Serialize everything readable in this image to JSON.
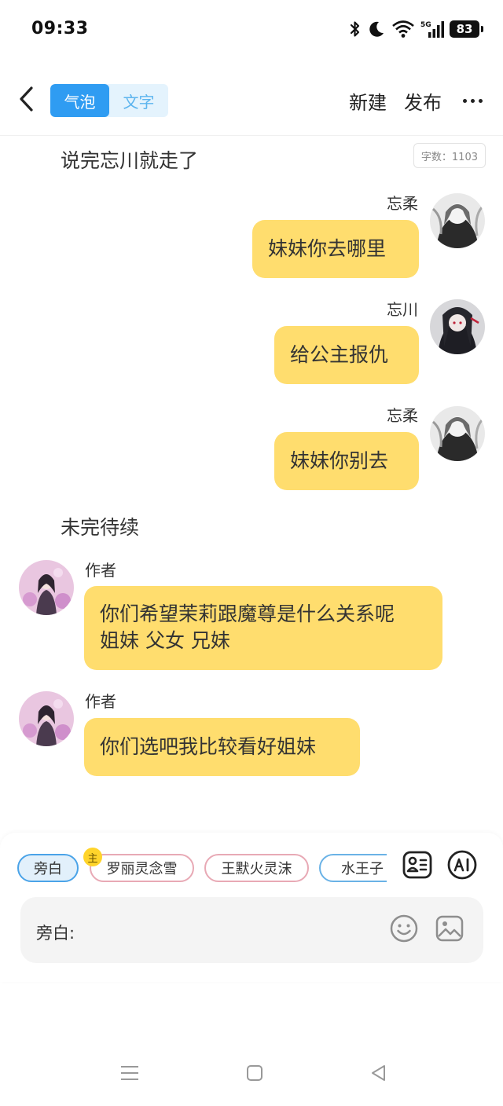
{
  "status_bar": {
    "time": "09:33",
    "battery": "83",
    "icons": [
      "bluetooth-icon",
      "moon-icon",
      "wifi-icon",
      "cellular-5g-icon",
      "battery-icon"
    ]
  },
  "header": {
    "back_icon": "chevron-left-icon",
    "tabs": [
      {
        "label": "气泡",
        "active": true
      },
      {
        "label": "文字",
        "active": false
      }
    ],
    "new_label": "新建",
    "publish_label": "发布",
    "more_icon": "more-dots-icon"
  },
  "word_count": "字数：1103",
  "messages": [
    {
      "type": "narration",
      "text": "说完忘川就走了"
    },
    {
      "type": "bubble",
      "side": "right",
      "speaker": "忘柔",
      "text": "妹妹你去哪里"
    },
    {
      "type": "bubble",
      "side": "right",
      "speaker": "忘川",
      "text": "给公主报仇"
    },
    {
      "type": "bubble",
      "side": "right",
      "speaker": "忘柔",
      "text": "妹妹你别去"
    },
    {
      "type": "narration",
      "text": "未完待续"
    },
    {
      "type": "bubble",
      "side": "left",
      "speaker": "作者",
      "line1": "你们希望茉莉跟魔尊是什么关系呢",
      "line2": "姐妹 父女 兄妹"
    },
    {
      "type": "bubble",
      "side": "left",
      "speaker": "作者",
      "text": "你们选吧我比较看好姐妹"
    }
  ],
  "composer": {
    "characters": [
      {
        "label": "旁白",
        "selected": true
      },
      {
        "label": "罗丽灵念雪",
        "badge": "主"
      },
      {
        "label": "王默火灵沫"
      },
      {
        "label": "水王子"
      }
    ],
    "tool_icons": [
      "character-card-icon",
      "ai-icon"
    ],
    "input_label": "旁白:",
    "input_icons": [
      "emoji-icon",
      "image-icon"
    ]
  },
  "nav": [
    "menu-icon",
    "home-square-icon",
    "back-triangle-icon"
  ],
  "colors": {
    "accent_blue": "#2f9cf2",
    "bubble_yellow": "#ffdd6e",
    "chip_pink": "#e8a9b5",
    "badge_yellow": "#ffd42b"
  }
}
